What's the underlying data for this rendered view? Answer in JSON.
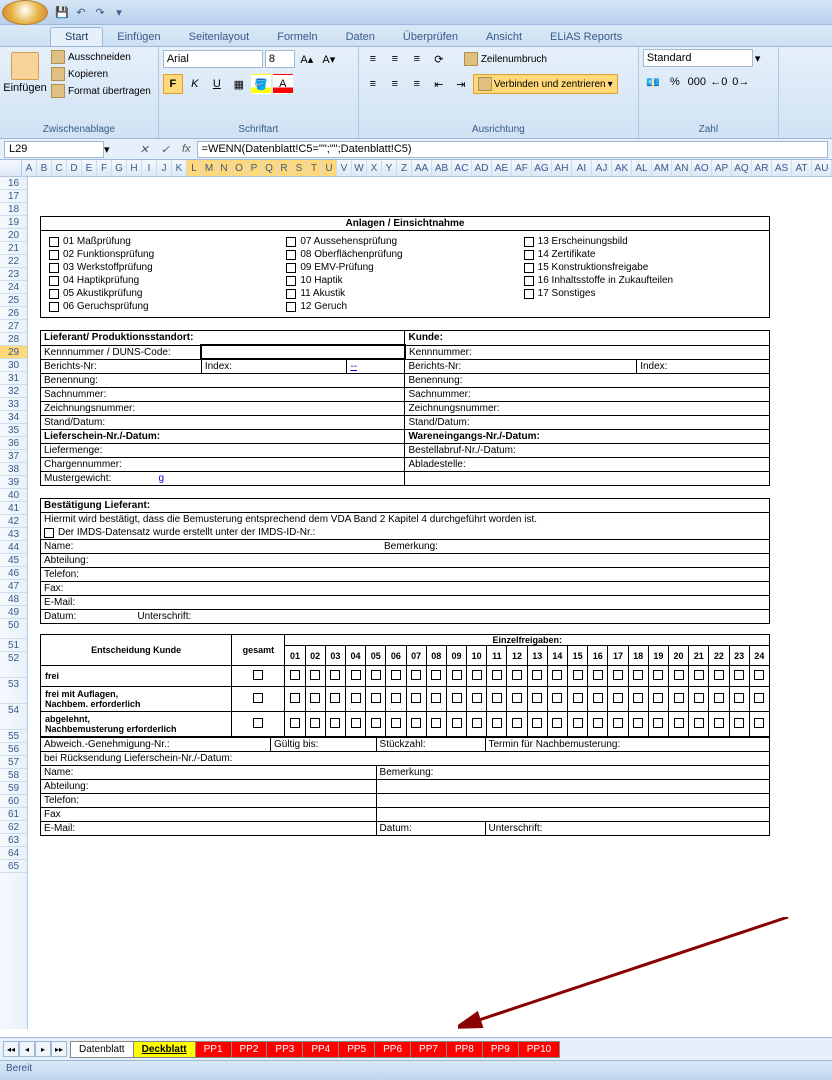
{
  "tabs": [
    "Start",
    "Einfügen",
    "Seitenlayout",
    "Formeln",
    "Daten",
    "Überprüfen",
    "Ansicht",
    "ELiAS Reports"
  ],
  "clipboard": {
    "paste": "Einfügen",
    "cut": "Ausschneiden",
    "copy": "Kopieren",
    "format": "Format übertragen",
    "label": "Zwischenablage"
  },
  "font": {
    "name": "Arial",
    "size": "8",
    "label": "Schriftart"
  },
  "align": {
    "wrap": "Zeilenumbruch",
    "merge": "Verbinden und zentrieren",
    "label": "Ausrichtung"
  },
  "number": {
    "format": "Standard",
    "label": "Zahl"
  },
  "namebox": "L29",
  "formula": "=WENN(Datenblatt!C5=\"\";\"\";Datenblatt!C5)",
  "cols": [
    "A",
    "B",
    "C",
    "D",
    "E",
    "F",
    "G",
    "H",
    "I",
    "J",
    "K",
    "L",
    "M",
    "N",
    "O",
    "P",
    "Q",
    "R",
    "S",
    "T",
    "U",
    "V",
    "W",
    "X",
    "Y",
    "Z",
    "AA",
    "AB",
    "AC",
    "AD",
    "AE",
    "AF",
    "AG",
    "AH",
    "AI",
    "AJ",
    "AK",
    "AL",
    "AM",
    "AN",
    "AO",
    "AP",
    "AQ",
    "AR",
    "AS",
    "AT",
    "AU"
  ],
  "rows_start": 16,
  "rows_end": 65,
  "form": {
    "anlagen_title": "Anlagen / Einsichtnahme",
    "anlagen": [
      [
        "01 Maßprüfung",
        "02 Funktionsprüfung",
        "03 Werkstoffprüfung",
        "04 Haptikprüfung",
        "05 Akustikprüfung",
        "06 Geruchsprüfung"
      ],
      [
        "07 Aussehensprüfung",
        "08 Oberflächenprüfung",
        "09 EMV-Prüfung",
        "10 Haptik",
        "11 Akustik",
        "12 Geruch"
      ],
      [
        "13 Erscheinungsbild",
        "14 Zertifikate",
        "15 Konstruktionsfreigabe",
        "16 Inhaltsstoffe in Zukaufteilen",
        "17 Sonstiges"
      ]
    ],
    "lieferant": "Lieferant/ Produktionsstandort:",
    "kunde": "Kunde:",
    "kennnr": "Kennnummer / DUNS-Code:",
    "kennnr2": "Kennnummer:",
    "berichts": "Berichts-Nr:",
    "index": "Index:",
    "dash": "--",
    "benennung": "Benennung:",
    "sachnr": "Sachnummer:",
    "zeichnr": "Zeichnungsnummer:",
    "stand": "Stand/Datum:",
    "liefer": "Lieferschein-Nr./-Datum:",
    "waren": "Wareneingangs-Nr./-Datum:",
    "liefermenge": "Liefermenge:",
    "bestell": "Bestellabruf-Nr./-Datum:",
    "chargen": "Chargennummer:",
    "ablade": "Abladestelle:",
    "muster": "Mustergewicht:",
    "g": "g",
    "best_hdr": "Bestätigung Lieferant:",
    "best_txt": "Hiermit wird bestätigt, dass die Bemusterung entsprechend dem VDA Band 2 Kapitel 4 durchgeführt worden ist.",
    "imds": "Der IMDS-Datensatz wurde erstellt unter der IMDS-ID-Nr.:",
    "name": "Name:",
    "abteilung": "Abteilung:",
    "telefon": "Telefon:",
    "fax": "Fax:",
    "email": "E-Mail:",
    "datum": "Datum:",
    "unterschrift": "Unterschrift:",
    "bemerkung": "Bemerkung:",
    "entscheidung": "Entscheidung Kunde",
    "gesamt": "gesamt",
    "einzel": "Einzelfreigaben:",
    "frei": "frei",
    "frei_auflagen": "frei mit Auflagen,\nNachbem. erforderlich",
    "abgelehnt": "abgelehnt,\nNachbemusterung erforderlich",
    "abweich": "Abweich.-Genehmigung-Nr.:",
    "gueltig": "Gültig bis:",
    "stueck": "Stückzahl:",
    "termin": "Termin für Nachbemusterung:",
    "rueck": "bei Rücksendung Lieferschein-Nr./-Datum:",
    "fax2": "Fax"
  },
  "sheets": {
    "nav": [
      "◂◂",
      "◂",
      "▸",
      "▸▸"
    ],
    "white": "Datenblatt",
    "yellow": "Deckblatt",
    "red": [
      "PP1",
      "PP2",
      "PP3",
      "PP4",
      "PP5",
      "PP6",
      "PP7",
      "PP8",
      "PP9",
      "PP10"
    ]
  },
  "status": "Bereit"
}
